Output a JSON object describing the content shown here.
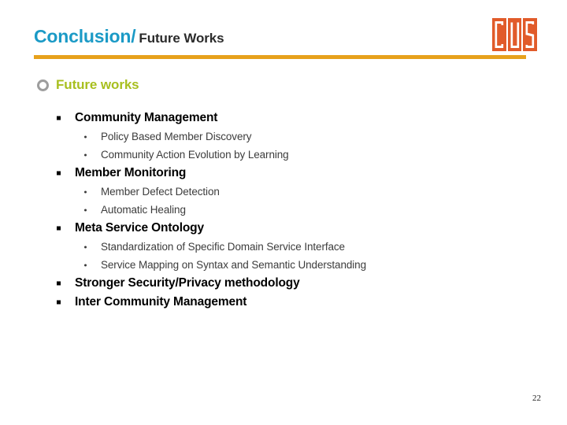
{
  "slide": {
    "title_main": "Conclusion/",
    "title_sub": "Future Works",
    "page_number": "22",
    "accent_rule_color": "#E7A11C",
    "title_main_color": "#1B9AC6",
    "title_sub_color": "#2B2B2B"
  },
  "logo": {
    "name": "CUS",
    "letters": [
      "C",
      "U",
      "S"
    ],
    "background_color": "#E15B2A",
    "letter_color": "#FFFFFF"
  },
  "section": {
    "heading": "Future works",
    "heading_color": "#A8BF1F",
    "bullet_icon": "ring-bullet-icon"
  },
  "outline": [
    {
      "level": 1,
      "text": "Community Management",
      "bullet_icon": "square-bullet-icon"
    },
    {
      "level": 2,
      "text": "Policy Based Member Discovery",
      "bullet_icon": "dot-bullet-icon"
    },
    {
      "level": 2,
      "text": "Community Action Evolution by Learning",
      "bullet_icon": "dot-bullet-icon"
    },
    {
      "level": 1,
      "text": "Member Monitoring",
      "bullet_icon": "square-bullet-icon"
    },
    {
      "level": 2,
      "text": "Member Defect Detection",
      "bullet_icon": "dot-bullet-icon"
    },
    {
      "level": 2,
      "text": "Automatic Healing",
      "bullet_icon": "dot-bullet-icon"
    },
    {
      "level": 1,
      "text": "Meta Service Ontology",
      "bullet_icon": "square-bullet-icon"
    },
    {
      "level": 2,
      "text": "Standardization of Specific Domain Service Interface",
      "bullet_icon": "dot-bullet-icon"
    },
    {
      "level": 2,
      "text": "Service Mapping on Syntax and Semantic Understanding",
      "bullet_icon": "dot-bullet-icon"
    },
    {
      "level": 1,
      "text": "Stronger Security/Privacy methodology",
      "bullet_icon": "square-bullet-icon"
    },
    {
      "level": 1,
      "text": "Inter Community Management",
      "bullet_icon": "square-bullet-icon"
    }
  ]
}
